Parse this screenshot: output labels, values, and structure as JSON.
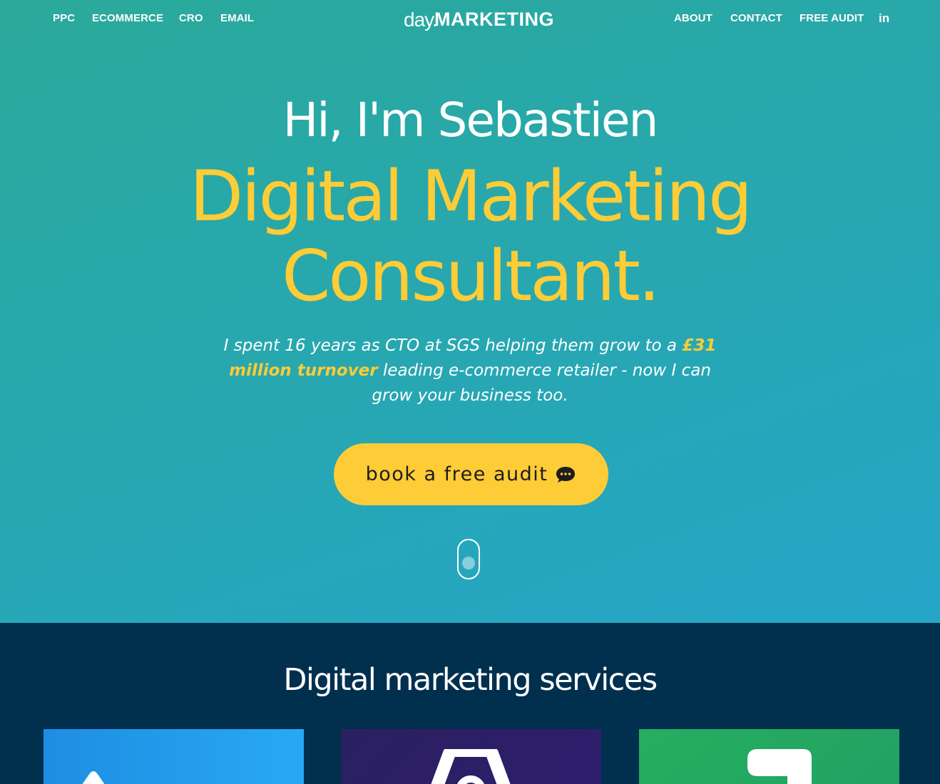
{
  "nav": {
    "left": [
      "PPC",
      "ECOMMERCE",
      "CRO",
      "EMAIL"
    ],
    "right": [
      "ABOUT",
      "CONTACT",
      "FREE AUDIT"
    ],
    "social": "in"
  },
  "logo": {
    "prefix": "day.",
    "brand": "MARKETING"
  },
  "hero": {
    "greeting": "Hi, I'm Sebastien",
    "title": "Digital Marketing Consultant.",
    "intro_before": "I spent 16 years as CTO at SGS helping them grow to a ",
    "intro_highlight": "£31 million turnover",
    "intro_after": " leading e-commerce retailer - now I can grow your business too.",
    "cta_label": "book a free audit"
  },
  "services": {
    "heading": "Digital marketing services"
  },
  "colors": {
    "accent": "#fdcc37",
    "hero_gradient_start": "#2aa99a",
    "hero_gradient_end": "#25a6c8",
    "section_dark": "#012f4e",
    "card_blue": "#28a9f3",
    "card_purple": "#2f1d6e",
    "card_green": "#27ae60"
  },
  "icons": [
    "flask-icon",
    "linkedin-icon",
    "chat-bubble-icon",
    "scroll-mouse-icon"
  ]
}
